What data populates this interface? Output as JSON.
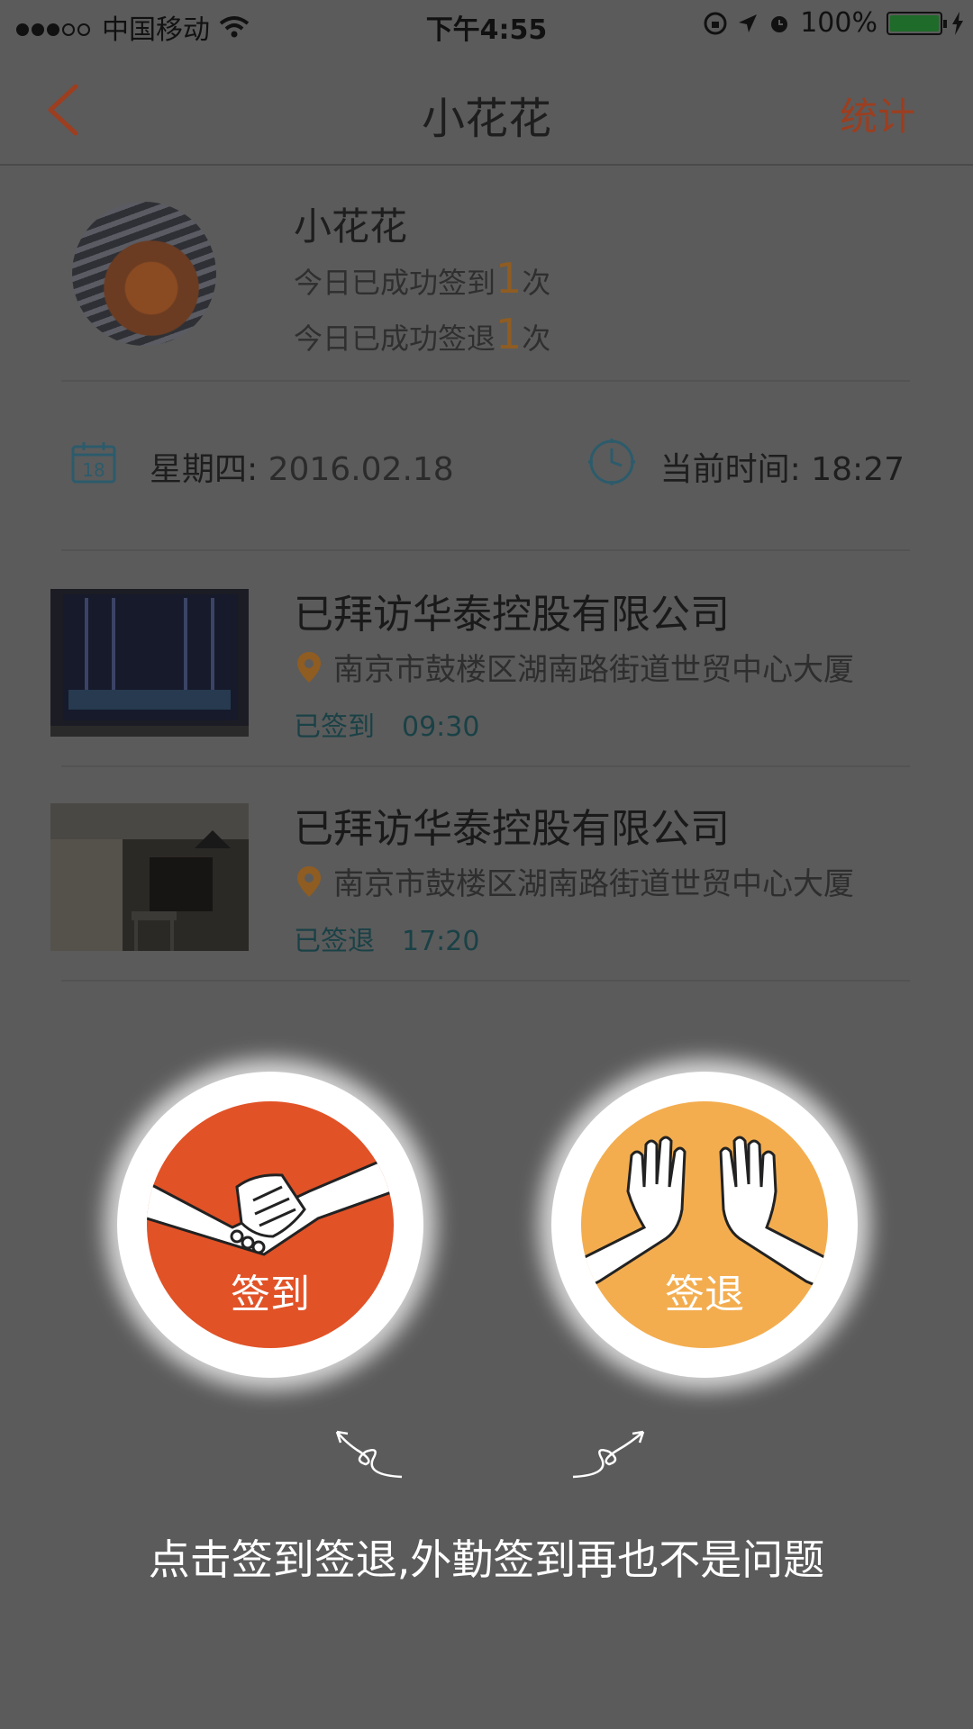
{
  "status_bar": {
    "carrier": "中国移动",
    "time": "下午4:55",
    "battery": "100%"
  },
  "nav": {
    "title": "小花花",
    "right_action": "统计"
  },
  "profile": {
    "name": "小花花",
    "checkin_prefix": "今日已成功签到",
    "checkin_count": "1",
    "checkin_suffix": "次",
    "checkout_prefix": "今日已成功签退",
    "checkout_count": "1",
    "checkout_suffix": "次"
  },
  "date_row": {
    "calendar_day": "18",
    "weekday_label": "星期四:",
    "date": "2016.02.18",
    "time_label": "当前时间:",
    "time": "18:27"
  },
  "visits": [
    {
      "title": "已拜访华泰控股有限公司",
      "address": "南京市鼓楼区湖南路街道世贸中心大厦",
      "status": "已签到",
      "time": "09:30"
    },
    {
      "title": "已拜访华泰控股有限公司",
      "address": "南京市鼓楼区湖南路街道世贸中心大厦",
      "status": "已签退",
      "time": "17:20"
    }
  ],
  "buttons": {
    "checkin": "签到",
    "checkout": "签退"
  },
  "tagline": "点击签到签退,外勤签到再也不是问题",
  "colors": {
    "checkin": "#e15227",
    "checkout": "#f3ad4f",
    "accent_text": "#9c3e1f",
    "teal_icons": "#2c5b6b"
  }
}
